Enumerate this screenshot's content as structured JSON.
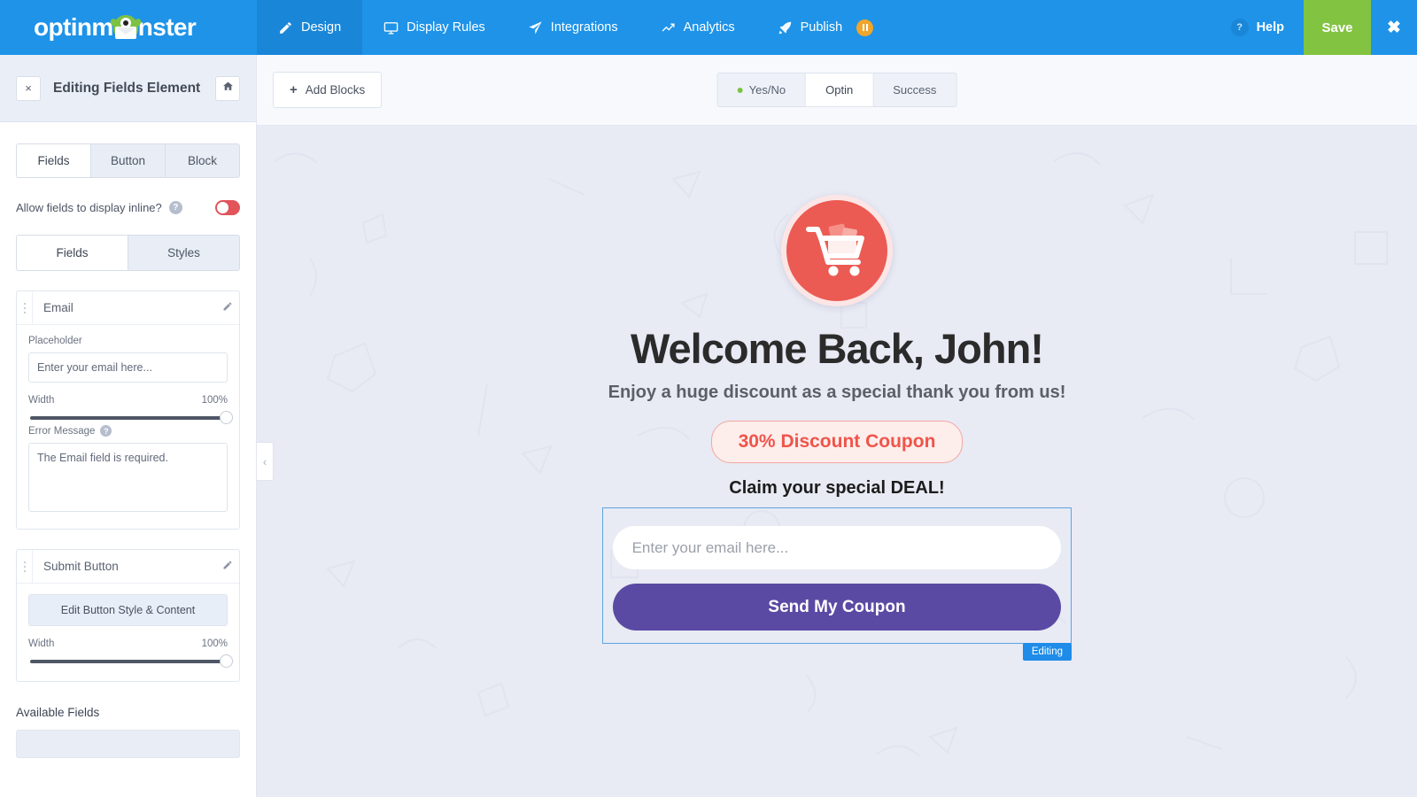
{
  "topbar": {
    "brand": "optinm nster",
    "brand_part1": "optinm",
    "brand_part2": "nster",
    "nav": [
      {
        "label": "Design",
        "icon": "pencil-icon",
        "active": true
      },
      {
        "label": "Display Rules",
        "icon": "monitor-icon",
        "active": false
      },
      {
        "label": "Integrations",
        "icon": "paper-plane-icon",
        "active": false
      },
      {
        "label": "Analytics",
        "icon": "chart-line-icon",
        "active": false
      },
      {
        "label": "Publish",
        "icon": "rocket-icon",
        "active": false,
        "badge": "paused"
      }
    ],
    "help_label": "Help",
    "help_symbol": "?",
    "save_label": "Save",
    "close_symbol": "✖",
    "accent_blue": "#1e93e8",
    "save_green": "#82c341",
    "badge_orange": "#f0a52b"
  },
  "sidebar": {
    "close_symbol": "×",
    "title": "Editing Fields Element",
    "home_icon": "home-icon",
    "main_tabs": [
      {
        "label": "Fields",
        "active": true
      },
      {
        "label": "Button",
        "active": false
      },
      {
        "label": "Block",
        "active": false
      }
    ],
    "inline_toggle": {
      "label": "Allow fields to display inline?",
      "help_symbol": "?",
      "state": "off",
      "color": "#e0545a"
    },
    "sub_tabs": [
      {
        "label": "Fields",
        "active": true
      },
      {
        "label": "Styles",
        "active": false
      }
    ],
    "email_card": {
      "title": "Email",
      "edit_icon": "pencil-icon",
      "placeholder_label": "Placeholder",
      "placeholder_value": "Enter your email here...",
      "width_label": "Width",
      "width_value": "100%",
      "error_label": "Error Message",
      "error_help_symbol": "?",
      "error_value": "The Email field is required."
    },
    "submit_card": {
      "title": "Submit Button",
      "edit_icon": "pencil-icon",
      "edit_button_label": "Edit Button Style & Content",
      "width_label": "Width",
      "width_value": "100%"
    },
    "available_fields_label": "Available Fields"
  },
  "canvas": {
    "add_blocks_label": "Add Blocks",
    "add_blocks_plus": "+",
    "view_tabs": [
      {
        "label": "Yes/No",
        "active": false,
        "dot": true
      },
      {
        "label": "Optin",
        "active": true,
        "dot": false
      },
      {
        "label": "Success",
        "active": false,
        "dot": false
      }
    ],
    "collapse_chevron": "‹",
    "background_color": "#e8eaf4"
  },
  "optin": {
    "icon": "shopping-cart-icon",
    "icon_bg": "#eb5b53",
    "headline": "Welcome Back, John!",
    "subline": "Enjoy a huge discount as a special thank you from us!",
    "coupon": "30% Discount Coupon",
    "coupon_color": "#f0544a",
    "claim": "Claim your special DEAL!",
    "email_placeholder": "Enter your email here...",
    "submit_label": "Send My Coupon",
    "submit_color": "#5b4aa3",
    "editing_badge": "Editing",
    "editing_badge_color": "#1e8ce8"
  }
}
